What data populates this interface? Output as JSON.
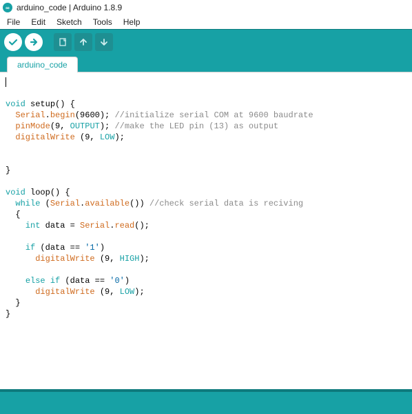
{
  "window": {
    "title": "arduino_code | Arduino 1.8.9"
  },
  "menu": {
    "file": "File",
    "edit": "Edit",
    "sketch": "Sketch",
    "tools": "Tools",
    "help": "Help"
  },
  "toolbar": {
    "verify": "verify",
    "upload": "upload",
    "new": "new",
    "open": "open",
    "save": "save"
  },
  "tabs": {
    "current": "arduino_code"
  },
  "code": {
    "lines": {
      "l0": "",
      "setup_sig_kw": "void",
      "setup_sig_name": " setup",
      "setup_sig_rest": "() {",
      "sb_indent": "  ",
      "sb_obj": "Serial",
      "sb_dot": ".",
      "sb_fn": "begin",
      "sb_args": "(9600);",
      "sb_cmt": " //initialize serial COM at 9600 baudrate",
      "pm_indent": "  ",
      "pm_fn": "pinMode",
      "pm_open": "(9, ",
      "pm_const": "OUTPUT",
      "pm_close": ");",
      "pm_cmt": " //make the LED pin (13) as output",
      "dw1_indent": "  ",
      "dw1_fn": "digitalWrite",
      "dw1_open": " (9, ",
      "dw1_const": "LOW",
      "dw1_close": ");",
      "close1": "}",
      "loop_kw": "void",
      "loop_name": " loop",
      "loop_rest": "() {",
      "wh_indent": "  ",
      "wh_kw": "while",
      "wh_open": " (",
      "wh_obj": "Serial",
      "wh_dot": ".",
      "wh_fn": "available",
      "wh_close": "())",
      "wh_cmt": " //check serial data is reciving",
      "brace_open": "  {",
      "rd_indent": "    ",
      "rd_kw": "int",
      "rd_mid": " data = ",
      "rd_obj": "Serial",
      "rd_dot": ".",
      "rd_fn": "read",
      "rd_close": "();",
      "if_indent": "    ",
      "if_kw": "if",
      "if_open": " (data == ",
      "if_str": "'1'",
      "if_close": ")",
      "dw2_indent": "      ",
      "dw2_fn": "digitalWrite",
      "dw2_open": " (9, ",
      "dw2_const": "HIGH",
      "dw2_close": ");",
      "el_indent": "    ",
      "el_kw": "else if",
      "el_open": " (data == ",
      "el_str": "'0'",
      "el_close": ")",
      "dw3_indent": "      ",
      "dw3_fn": "digitalWrite",
      "dw3_open": " (9, ",
      "dw3_const": "LOW",
      "dw3_close": ");",
      "brace_close_inner": "  }",
      "brace_close_outer": "}"
    }
  }
}
